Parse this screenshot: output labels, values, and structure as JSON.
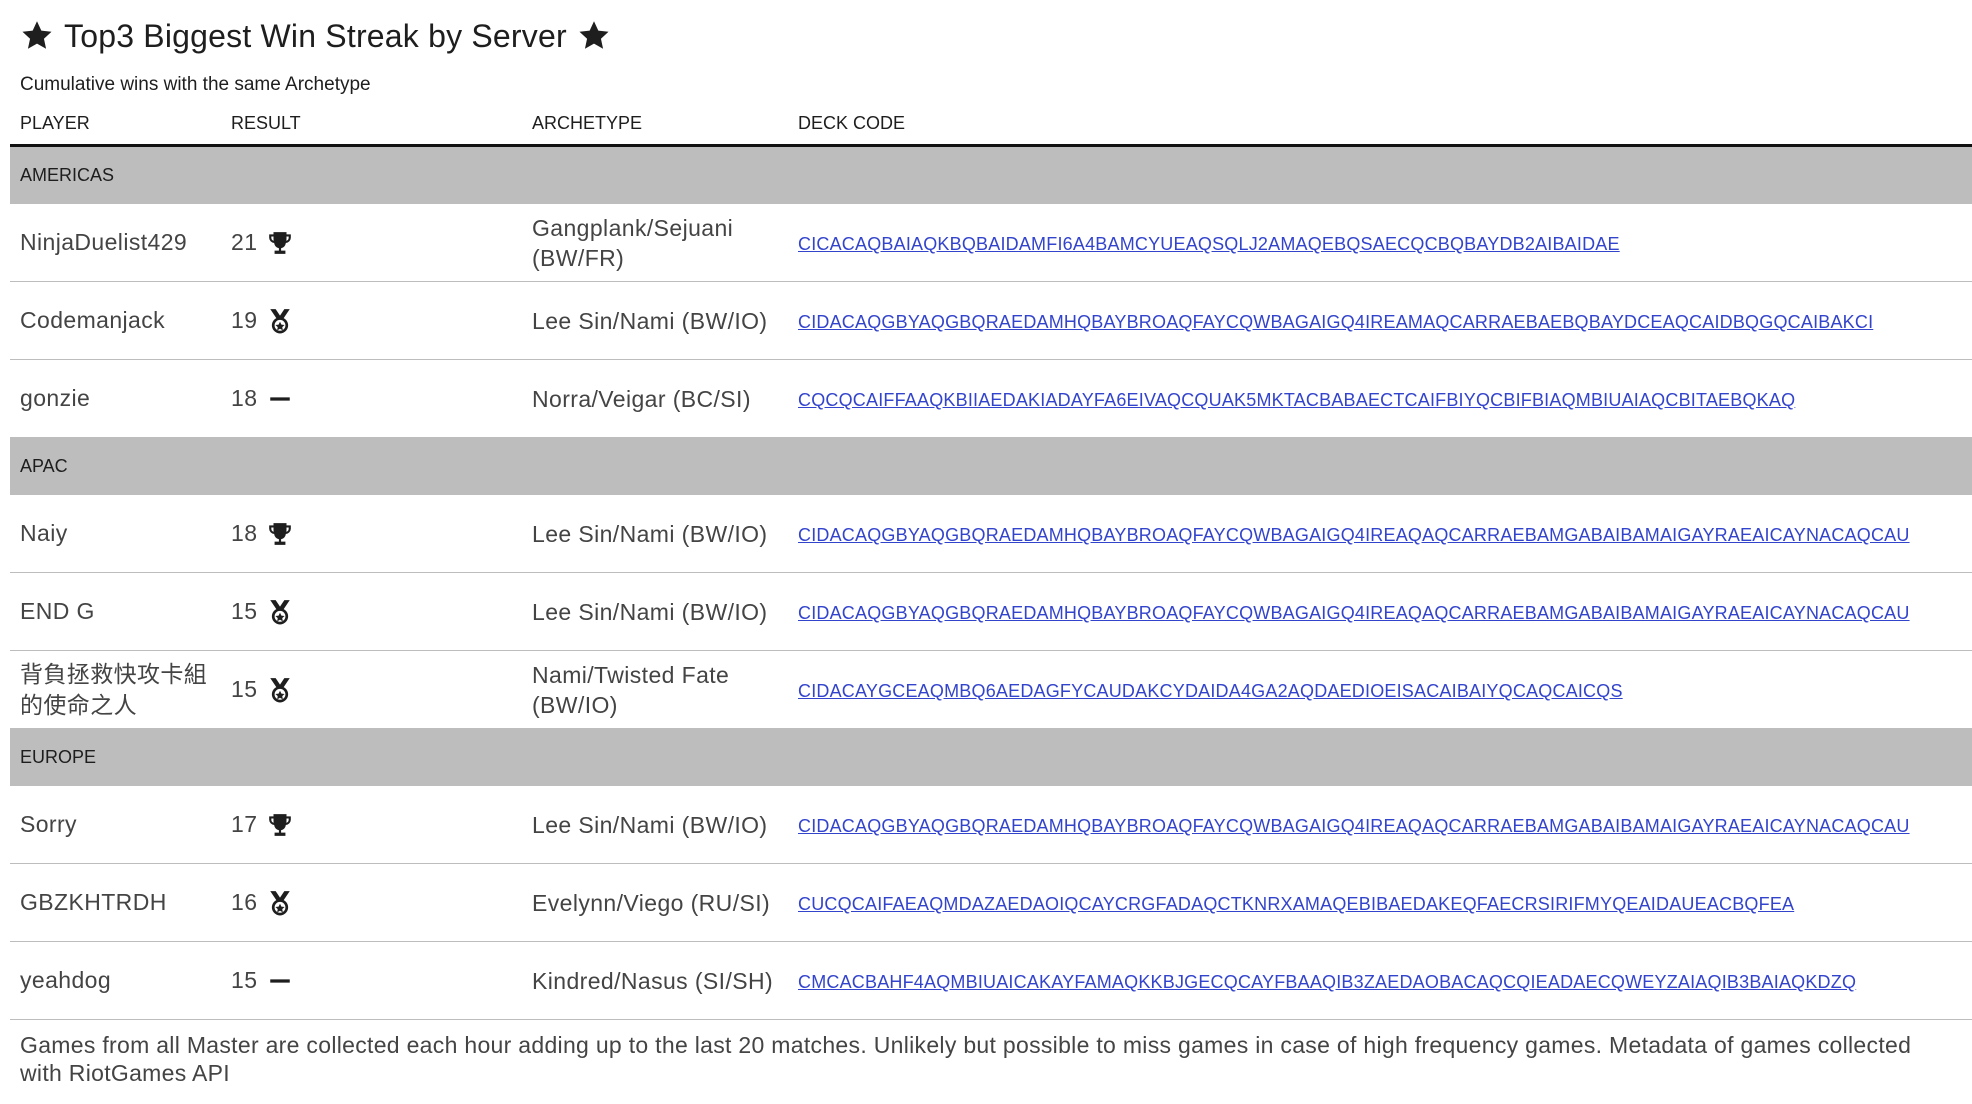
{
  "header": {
    "title": "Top3 Biggest Win Streak by Server",
    "subtitle": "Cumulative wins with the same Archetype"
  },
  "table": {
    "columns": [
      "PLAYER",
      "RESULT",
      "ARCHETYPE",
      "DECK CODE"
    ]
  },
  "regions": [
    {
      "name": "AMERICAS",
      "rows": [
        {
          "player": "NinjaDuelist429",
          "wins": "21",
          "rank_icon": "trophy-icon",
          "archetype": "Gangplank/Sejuani (BW/FR)",
          "deck_code": "CICACAQBAIAQKBQBAIDAMFI6A4BAMCYUEAQSQLJ2AMAQEBQSAECQCBQBAYDB2AIBAIDAE"
        },
        {
          "player": "Codemanjack",
          "wins": "19",
          "rank_icon": "medal-icon",
          "archetype": "Lee Sin/Nami (BW/IO)",
          "deck_code": "CIDACAQGBYAQGBQRAEDAMHQBAYBROAQFAYCQWBAGAIGQ4IREAMAQCARRAEBAEBQBAYDCEAQCAIDBQGQCAIBAKCI"
        },
        {
          "player": "gonzie",
          "wins": "18",
          "rank_icon": "dash-icon",
          "archetype": "Norra/Veigar (BC/SI)",
          "deck_code": "CQCQCAIFFAAQKBIIAEDAKIADAYFA6EIVAQCQUAK5MKTACBABAECTCAIFBIYQCBIFBIAQMBIUAIAQCBITAEBQKAQ"
        }
      ]
    },
    {
      "name": "APAC",
      "rows": [
        {
          "player": "Naiy",
          "wins": "18",
          "rank_icon": "trophy-icon",
          "archetype": "Lee Sin/Nami (BW/IO)",
          "deck_code": "CIDACAQGBYAQGBQRAEDAMHQBAYBROAQFAYCQWBAGAIGQ4IREAQAQCARRAEBAMGABAIBAMAIGAYRAEAICAYNACAQCAU"
        },
        {
          "player": "END G",
          "wins": "15",
          "rank_icon": "medal-icon",
          "archetype": "Lee Sin/Nami (BW/IO)",
          "deck_code": "CIDACAQGBYAQGBQRAEDAMHQBAYBROAQFAYCQWBAGAIGQ4IREAQAQCARRAEBAMGABAIBAMAIGAYRAEAICAYNACAQCAU"
        },
        {
          "player": "背負拯救快攻卡組的使命之人",
          "wins": "15",
          "rank_icon": "medal-icon",
          "archetype": "Nami/Twisted Fate (BW/IO)",
          "deck_code": "CIDACAYGCEAQMBQ6AEDAGFYCAUDAKCYDAIDA4GA2AQDAEDIOEISACAIBAIYQCAQCAICQS"
        }
      ]
    },
    {
      "name": "EUROPE",
      "rows": [
        {
          "player": "Sorry",
          "wins": "17",
          "rank_icon": "trophy-icon",
          "archetype": "Lee Sin/Nami (BW/IO)",
          "deck_code": "CIDACAQGBYAQGBQRAEDAMHQBAYBROAQFAYCQWBAGAIGQ4IREAQAQCARRAEBAMGABAIBAMAIGAYRAEAICAYNACAQCAU"
        },
        {
          "player": "GBZKHTRDH",
          "wins": "16",
          "rank_icon": "medal-icon",
          "archetype": "Evelynn/Viego (RU/SI)",
          "deck_code": "CUCQCAIFAEAQMDAZAEDAOIQCAYCRGFADAQCTKNRXAMAQEBIBAEDAKEQFAECRSIRIFMYQEAIDAUEACBQFEA"
        },
        {
          "player": "yeahdog",
          "wins": "15",
          "rank_icon": "dash-icon",
          "archetype": "Kindred/Nasus (SI/SH)",
          "deck_code": "CMCACBAHF4AQMBIUAICAKAYFAMAQKKBJGECQCAYFBAAQIB3ZAEDAOBACAQCQIEADAECQWEYZAIAQIB3BAIAQKDZQ"
        }
      ]
    }
  ],
  "footer": {
    "note": "Games from all Master are collected each hour adding up to the last 20 matches. Unlikely but possible to miss games in case of high frequency games. Metadata of games collected with RiotGames API"
  },
  "icons": {
    "title_left": "star-icon",
    "title_right": "star-icon"
  },
  "colors": {
    "region_band": "#bdbdbd",
    "link": "#3344cc",
    "header_rule": "#111111"
  }
}
